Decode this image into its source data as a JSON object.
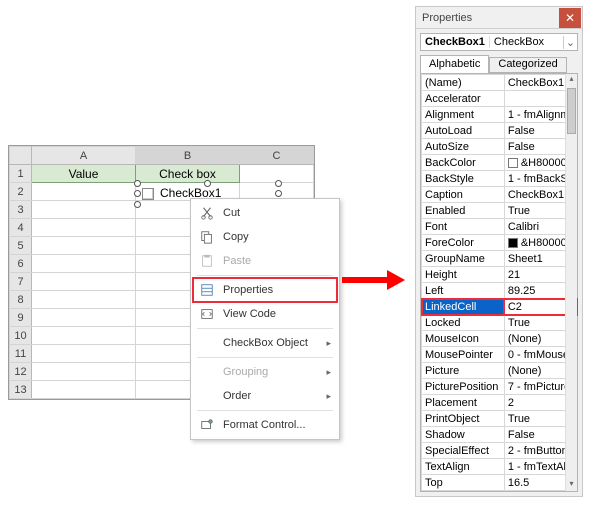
{
  "sheet": {
    "cols": [
      "A",
      "B",
      "C"
    ],
    "rows": [
      "1",
      "2",
      "3",
      "4",
      "5",
      "6",
      "7",
      "8",
      "9",
      "10",
      "11",
      "12",
      "13"
    ],
    "h1": "Value",
    "h2": "Check box"
  },
  "checkbox_object": {
    "label": "CheckBox1"
  },
  "context_menu": {
    "cut": "Cut",
    "copy": "Copy",
    "paste": "Paste",
    "properties": "Properties",
    "view_code": "View Code",
    "cbobj": "CheckBox Object",
    "grouping": "Grouping",
    "order": "Order",
    "format": "Format Control..."
  },
  "props": {
    "title": "Properties",
    "obj_name": "CheckBox1",
    "obj_type": "CheckBox",
    "tab_alpha": "Alphabetic",
    "tab_cat": "Categorized",
    "rows": [
      {
        "k": "(Name)",
        "v": "CheckBox1"
      },
      {
        "k": "Accelerator",
        "v": ""
      },
      {
        "k": "Alignment",
        "v": "1 - fmAlignm"
      },
      {
        "k": "AutoLoad",
        "v": "False"
      },
      {
        "k": "AutoSize",
        "v": "False"
      },
      {
        "k": "BackColor",
        "v": "&H80000",
        "swatch": "#ffffff"
      },
      {
        "k": "BackStyle",
        "v": "1 - fmBackSt"
      },
      {
        "k": "Caption",
        "v": "CheckBox1"
      },
      {
        "k": "Enabled",
        "v": "True"
      },
      {
        "k": "Font",
        "v": "Calibri"
      },
      {
        "k": "ForeColor",
        "v": "&H80000",
        "swatch": "#000000"
      },
      {
        "k": "GroupName",
        "v": "Sheet1"
      },
      {
        "k": "Height",
        "v": "21"
      },
      {
        "k": "Left",
        "v": "89.25"
      },
      {
        "k": "LinkedCell",
        "v": "C2",
        "sel": true,
        "boxed": true
      },
      {
        "k": "Locked",
        "v": "True"
      },
      {
        "k": "MouseIcon",
        "v": "(None)"
      },
      {
        "k": "MousePointer",
        "v": "0 - fmMouse"
      },
      {
        "k": "Picture",
        "v": "(None)"
      },
      {
        "k": "PicturePosition",
        "v": "7 - fmPicture"
      },
      {
        "k": "Placement",
        "v": "2"
      },
      {
        "k": "PrintObject",
        "v": "True"
      },
      {
        "k": "Shadow",
        "v": "False"
      },
      {
        "k": "SpecialEffect",
        "v": "2 - fmButton"
      },
      {
        "k": "TextAlign",
        "v": "1 - fmTextAl"
      },
      {
        "k": "Top",
        "v": "16.5"
      }
    ]
  }
}
